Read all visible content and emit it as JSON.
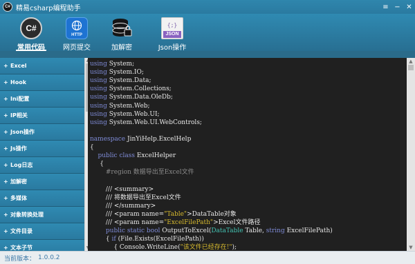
{
  "window": {
    "logo_text": "C#",
    "title": "精易csharp编程助手",
    "buttons": {
      "menu": "≡",
      "minimize": "−",
      "close": "✕"
    }
  },
  "toolbar": {
    "tabs": [
      {
        "label": "常用代码",
        "icon": "csharp-icon",
        "icon_text": "C#",
        "active": true
      },
      {
        "label": "网页提交",
        "icon": "http-icon",
        "icon_text": "HTTP",
        "active": false
      },
      {
        "label": "加解密",
        "icon": "database-lock-icon",
        "active": false
      },
      {
        "label": "Json操作",
        "icon": "json-file-icon",
        "icon_text": "JSON",
        "icon_sub": "{;}",
        "active": false
      }
    ]
  },
  "sidebar": {
    "items": [
      {
        "label": "Excel"
      },
      {
        "label": "Hook"
      },
      {
        "label": "Ini配置"
      },
      {
        "label": "IP相关"
      },
      {
        "label": "Json操作"
      },
      {
        "label": "Js操作"
      },
      {
        "label": "Log日志"
      },
      {
        "label": "加解密"
      },
      {
        "label": "多媒体"
      },
      {
        "label": "对象转换处理"
      },
      {
        "label": "文件目录"
      },
      {
        "label": "文本子节"
      }
    ]
  },
  "editor": {
    "lines": [
      [
        {
          "t": "using",
          "c": "kw"
        },
        {
          "t": " System;",
          "c": "st"
        }
      ],
      [
        {
          "t": "using",
          "c": "kw"
        },
        {
          "t": " System.IO;",
          "c": "st"
        }
      ],
      [
        {
          "t": "using",
          "c": "kw"
        },
        {
          "t": " System.Data;",
          "c": "st"
        }
      ],
      [
        {
          "t": "using",
          "c": "kw"
        },
        {
          "t": " System.Collections;",
          "c": "st"
        }
      ],
      [
        {
          "t": "using",
          "c": "kw"
        },
        {
          "t": " System.Data.OleDb;",
          "c": "st"
        }
      ],
      [
        {
          "t": "using",
          "c": "kw"
        },
        {
          "t": " System.Web;",
          "c": "st"
        }
      ],
      [
        {
          "t": "using",
          "c": "kw"
        },
        {
          "t": " System.Web.UI;",
          "c": "st"
        }
      ],
      [
        {
          "t": "using",
          "c": "kw"
        },
        {
          "t": " System.Web.UI.WebControls;",
          "c": "st"
        }
      ],
      [],
      [
        {
          "t": "namespace",
          "c": "kw"
        },
        {
          "t": " JinYiHelp.ExcelHelp",
          "c": "st"
        }
      ],
      [
        {
          "t": "{",
          "c": "st"
        }
      ],
      [
        {
          "t": "    ",
          "c": "st"
        },
        {
          "t": "public",
          "c": "kw"
        },
        {
          "t": " ",
          "c": "st"
        },
        {
          "t": "class",
          "c": "kw"
        },
        {
          "t": " ExcelHelper",
          "c": "st"
        }
      ],
      [
        {
          "t": "     {",
          "c": "st"
        }
      ],
      [
        {
          "t": "        ",
          "c": "st"
        },
        {
          "t": "#region 数据导出至Excel文件",
          "c": "cm"
        }
      ],
      [],
      [
        {
          "t": "        /// <summary>",
          "c": "st"
        }
      ],
      [
        {
          "t": "        /// 将数据导出至Excel文件",
          "c": "st"
        }
      ],
      [
        {
          "t": "        /// </summary>",
          "c": "st"
        }
      ],
      [
        {
          "t": "        /// <param name=",
          "c": "st"
        },
        {
          "t": "\"Table\"",
          "c": "str"
        },
        {
          "t": ">DataTable对象",
          "c": "st"
        }
      ],
      [
        {
          "t": "        /// <param name=",
          "c": "st"
        },
        {
          "t": "\"ExcelFilePath\"",
          "c": "str"
        },
        {
          "t": ">Excel文件路径",
          "c": "st"
        }
      ],
      [
        {
          "t": "        ",
          "c": "st"
        },
        {
          "t": "public",
          "c": "kw"
        },
        {
          "t": " ",
          "c": "st"
        },
        {
          "t": "static",
          "c": "kw"
        },
        {
          "t": " ",
          "c": "st"
        },
        {
          "t": "bool",
          "c": "kw"
        },
        {
          "t": " OutputToExcel(",
          "c": "st"
        },
        {
          "t": "DataTable",
          "c": "tp"
        },
        {
          "t": " Table, ",
          "c": "st"
        },
        {
          "t": "string",
          "c": "kw"
        },
        {
          "t": " ExcelFilePath)",
          "c": "st"
        }
      ],
      [
        {
          "t": "        { ",
          "c": "st"
        },
        {
          "t": "if",
          "c": "kw"
        },
        {
          "t": " (File.Exists(ExcelFilePath))",
          "c": "st"
        }
      ],
      [
        {
          "t": "            { Console.WriteLine(",
          "c": "st"
        },
        {
          "t": "\"该文件已经存在!\"",
          "c": "str"
        },
        {
          "t": ");",
          "c": "st"
        }
      ]
    ]
  },
  "status": {
    "label": "当前版本：",
    "version": "1.0.0.2"
  }
}
